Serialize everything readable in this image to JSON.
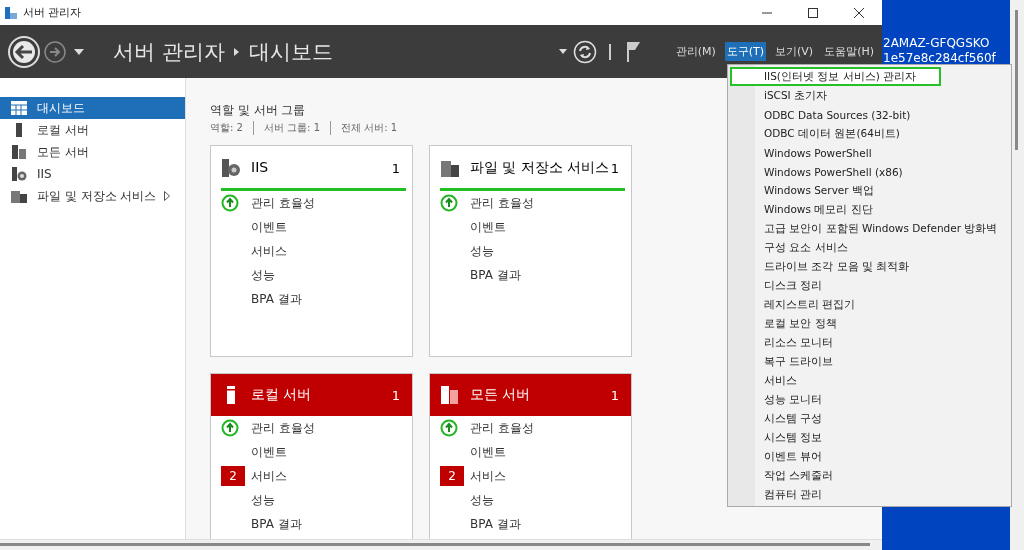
{
  "window": {
    "title": "서버 관리자"
  },
  "header": {
    "breadcrumb": [
      "서버 관리자",
      "대시보드"
    ],
    "menus": [
      {
        "label": "관리(M)",
        "selected": false
      },
      {
        "label": "도구(T)",
        "selected": true
      },
      {
        "label": "보기(V)",
        "selected": false
      },
      {
        "label": "도움말(H)",
        "selected": false
      }
    ]
  },
  "sidebar": {
    "items": [
      {
        "label": "대시보드",
        "kind": "dashboard",
        "selected": true,
        "expandable": false
      },
      {
        "label": "로컬 서버",
        "kind": "server",
        "selected": false,
        "expandable": false
      },
      {
        "label": "모든 서버",
        "kind": "servers",
        "selected": false,
        "expandable": false
      },
      {
        "label": "IIS",
        "kind": "iis",
        "selected": false,
        "expandable": false
      },
      {
        "label": "파일 및 저장소 서비스",
        "kind": "storage",
        "selected": false,
        "expandable": true
      }
    ]
  },
  "section": {
    "title": "역할 및 서버 그룹",
    "stats": [
      "역할: 2",
      "서버 그룹: 1",
      "전체 서버: 1"
    ]
  },
  "tiles": [
    {
      "name": "IIS",
      "count": "1",
      "kind": "iis",
      "alert": false,
      "rows": [
        {
          "label": "관리 효율성",
          "kind": "ok"
        },
        {
          "label": "이벤트",
          "kind": "plain"
        },
        {
          "label": "서비스",
          "kind": "plain"
        },
        {
          "label": "성능",
          "kind": "plain"
        },
        {
          "label": "BPA 결과",
          "kind": "plain"
        }
      ]
    },
    {
      "name": "파일 및 저장소 서비스",
      "count": "1",
      "kind": "storage",
      "alert": false,
      "rows": [
        {
          "label": "관리 효율성",
          "kind": "ok"
        },
        {
          "label": "이벤트",
          "kind": "plain"
        },
        {
          "label": "성능",
          "kind": "plain"
        },
        {
          "label": "BPA 결과",
          "kind": "plain"
        }
      ]
    },
    {
      "name": "로컬 서버",
      "count": "1",
      "kind": "server",
      "alert": true,
      "rows": [
        {
          "label": "관리 효율성",
          "kind": "ok"
        },
        {
          "label": "이벤트",
          "kind": "plain"
        },
        {
          "label": "서비스",
          "kind": "alert",
          "badge": "2"
        },
        {
          "label": "성능",
          "kind": "plain"
        },
        {
          "label": "BPA 결과",
          "kind": "plain"
        }
      ]
    },
    {
      "name": "모든 서버",
      "count": "1",
      "kind": "servers",
      "alert": true,
      "rows": [
        {
          "label": "관리 효율성",
          "kind": "ok"
        },
        {
          "label": "이벤트",
          "kind": "plain"
        },
        {
          "label": "서비스",
          "kind": "alert",
          "badge": "2"
        },
        {
          "label": "성능",
          "kind": "plain"
        },
        {
          "label": "BPA 결과",
          "kind": "plain"
        }
      ]
    }
  ],
  "tools_menu": {
    "items": [
      {
        "label": "IIS(인터넷 정보 서비스) 관리자",
        "selected": true
      },
      {
        "label": "iSCSI 초기자",
        "selected": false
      },
      {
        "label": "ODBC Data Sources (32-bit)",
        "selected": false
      },
      {
        "label": "ODBC 데이터 원본(64비트)",
        "selected": false
      },
      {
        "label": "Windows PowerShell",
        "selected": false
      },
      {
        "label": "Windows PowerShell (x86)",
        "selected": false
      },
      {
        "label": "Windows Server 백업",
        "selected": false
      },
      {
        "label": "Windows 메모리 진단",
        "selected": false
      },
      {
        "label": "고급 보안이 포함된 Windows Defender 방화벽",
        "selected": false
      },
      {
        "label": "구성 요소 서비스",
        "selected": false
      },
      {
        "label": "드라이브 조각 모음 및 최적화",
        "selected": false
      },
      {
        "label": "디스크 정리",
        "selected": false
      },
      {
        "label": "레지스트리 편집기",
        "selected": false
      },
      {
        "label": "로컬 보안 정책",
        "selected": false
      },
      {
        "label": "리소스 모니터",
        "selected": false
      },
      {
        "label": "복구 드라이브",
        "selected": false
      },
      {
        "label": "서비스",
        "selected": false
      },
      {
        "label": "성능 모니터",
        "selected": false
      },
      {
        "label": "시스템 구성",
        "selected": false
      },
      {
        "label": "시스템 정보",
        "selected": false
      },
      {
        "label": "이벤트 뷰어",
        "selected": false
      },
      {
        "label": "작업 스케줄러",
        "selected": false
      },
      {
        "label": "컴퓨터 관리",
        "selected": false
      }
    ]
  },
  "desktop": {
    "lines": [
      "2AMAZ-GFQGSKO",
      "1e57e8c284cf560f"
    ]
  }
}
